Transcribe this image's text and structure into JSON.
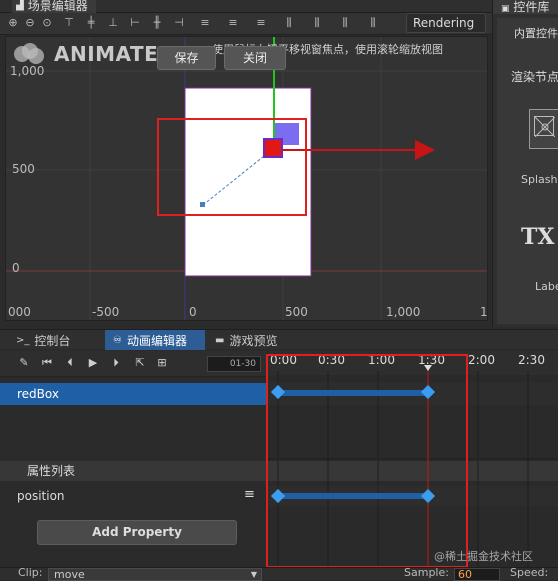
{
  "scene_editor": {
    "tab_label": "场景编辑器",
    "rendering_label": "Rendering",
    "logo_text": "ANIMATE",
    "save_label": "保存",
    "close_label": "关闭",
    "hint": "使用鼠标右键平移视窗焦点，使用滚轮缩放视图",
    "y_ticks": [
      "1,000",
      "500",
      "0"
    ],
    "x_ticks": [
      "000",
      "-500",
      "0",
      "500",
      "1,000",
      "1"
    ]
  },
  "right_panel": {
    "tab_label": "控件库",
    "section_label": "内置控件",
    "render_node_label": "渲染节点",
    "splash_label": "Splash",
    "label_label": "Label",
    "label_icon_text": "TX"
  },
  "bottom": {
    "tabs": [
      {
        "label": "控制台",
        "icon": "console-icon"
      },
      {
        "label": "动画编辑器",
        "icon": "animation-icon"
      },
      {
        "label": "游戏预览",
        "icon": "preview-icon"
      }
    ],
    "frame_range": "01-30",
    "node_name": "redBox",
    "property_header": "属性列表",
    "property_name": "position",
    "add_property_label": "Add Property",
    "timeline_ticks": [
      "0:00",
      "0:30",
      "1:00",
      "1:30",
      "2:00",
      "2:30"
    ],
    "clip_label": "Clip:",
    "clip_value": "move",
    "sample_label": "Sample:",
    "sample_value": "60",
    "speed_label": "Speed:"
  },
  "watermark": "@稀土掘金技术社区",
  "colors": {
    "accent_blue": "#1e5fa6",
    "keyframe": "#3b9cf0",
    "highlight_red": "#e02020",
    "red_box": "#e01818",
    "purple_box": "#7b6cf0"
  }
}
